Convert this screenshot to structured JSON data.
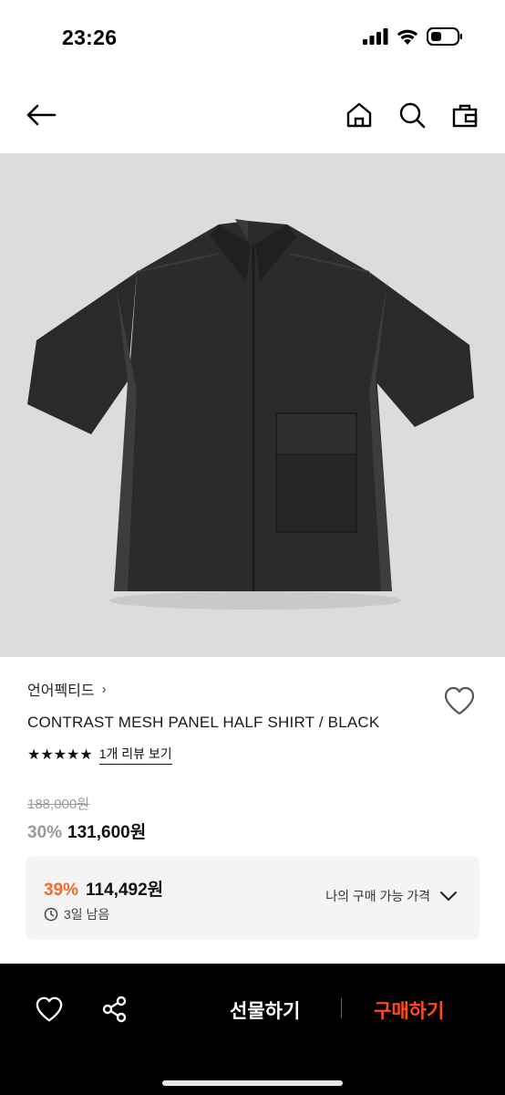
{
  "status": {
    "time": "23:26"
  },
  "nav": {
    "back_icon": "arrow-left-icon",
    "icons": [
      "home-icon",
      "search-icon",
      "shopping-bag-icon"
    ]
  },
  "product": {
    "brand": "언어펙티드",
    "brand_chevron": "›",
    "name": "CONTRAST MESH PANEL HALF SHIRT / BLACK",
    "rating_stars": 5,
    "review_link": "1개 리뷰 보기",
    "original_price": "188,000원",
    "sale_discount": "30%",
    "sale_price": "131,600원"
  },
  "my_price": {
    "discount": "39%",
    "amount": "114,492원",
    "timer": "3일 남음",
    "label": "나의 구매 가능 가격"
  },
  "bottom_bar": {
    "gift_label": "선물하기",
    "buy_label": "구매하기"
  },
  "colors": {
    "accent": "#ff4b1f",
    "discount": "#f06a2a",
    "image_bg": "#dcdcdc"
  }
}
